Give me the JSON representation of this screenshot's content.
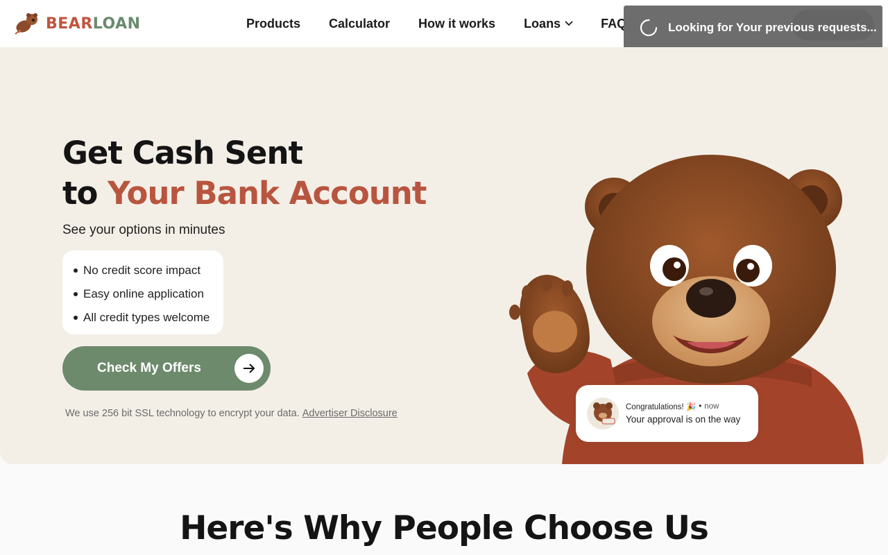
{
  "header": {
    "logo": {
      "part1": "BEAR",
      "part2": "LOAN"
    },
    "nav": [
      {
        "label": "Products"
      },
      {
        "label": "Calculator"
      },
      {
        "label": "How it works"
      },
      {
        "label": "Loans",
        "has_dropdown": true
      },
      {
        "label": "FAQ"
      }
    ]
  },
  "toast": {
    "text": "Looking for Your previous requests..."
  },
  "hero": {
    "title_line1": "Get Cash Sent",
    "title_line2_prefix": "to ",
    "title_line2_accent": "Your Bank Account",
    "subtitle": "See your options in minutes",
    "bullets": [
      "No credit score impact",
      "Easy online application",
      "All credit types welcome"
    ],
    "cta_label": "Check My Offers",
    "ssl_text": "We use 256 bit SSL technology to encrypt your data.",
    "disclosure_link": "Advertiser Disclosure"
  },
  "notification": {
    "title": "Congratulations! 🎉",
    "separator": "•",
    "time": "now",
    "message": "Your approval is on the way"
  },
  "section": {
    "title": "Here's Why People Choose Us"
  },
  "colors": {
    "accent": "#b8553f",
    "brand_green": "#6d8a6c",
    "hero_bg": "#f3efe7",
    "toast_bg": "#6b6b6b"
  }
}
